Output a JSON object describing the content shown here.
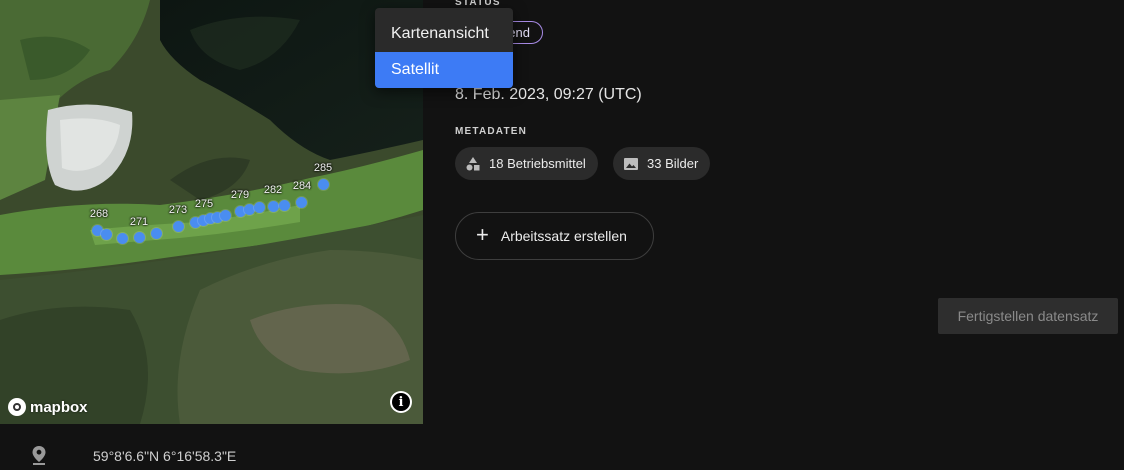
{
  "map": {
    "attribution_logo": "mapbox",
    "info_button": "i",
    "marker_color": "#4a8df0",
    "marker_labels": [
      "268",
      "271",
      "273",
      "275",
      "279",
      "282",
      "284",
      "285"
    ]
  },
  "menu": {
    "items": [
      {
        "label": "Kartenansicht",
        "selected": false
      },
      {
        "label": "Satellit",
        "selected": true
      }
    ],
    "highlight_color": "#3d7bf5"
  },
  "details": {
    "status_label": "STATUS",
    "status_value": "hend",
    "status_chip_color": "#a88be6",
    "date": "8. Feb. 2023, 09:27 (UTC)",
    "metadata_label": "METADATEN",
    "equipment_chip": "18 Betriebsmittel",
    "images_chip": "33 Bilder",
    "create_button": "Arbeitssatz erstellen",
    "finish_button": "Fertigstellen datensatz"
  },
  "location": {
    "coordinates": "59°8'6.6\"N 6°16'58.3\"E"
  },
  "icons": {
    "pin": "location-pin-icon",
    "shapes": "shapes-icon",
    "image": "image-icon",
    "plus": "plus-icon",
    "info": "info-icon"
  }
}
